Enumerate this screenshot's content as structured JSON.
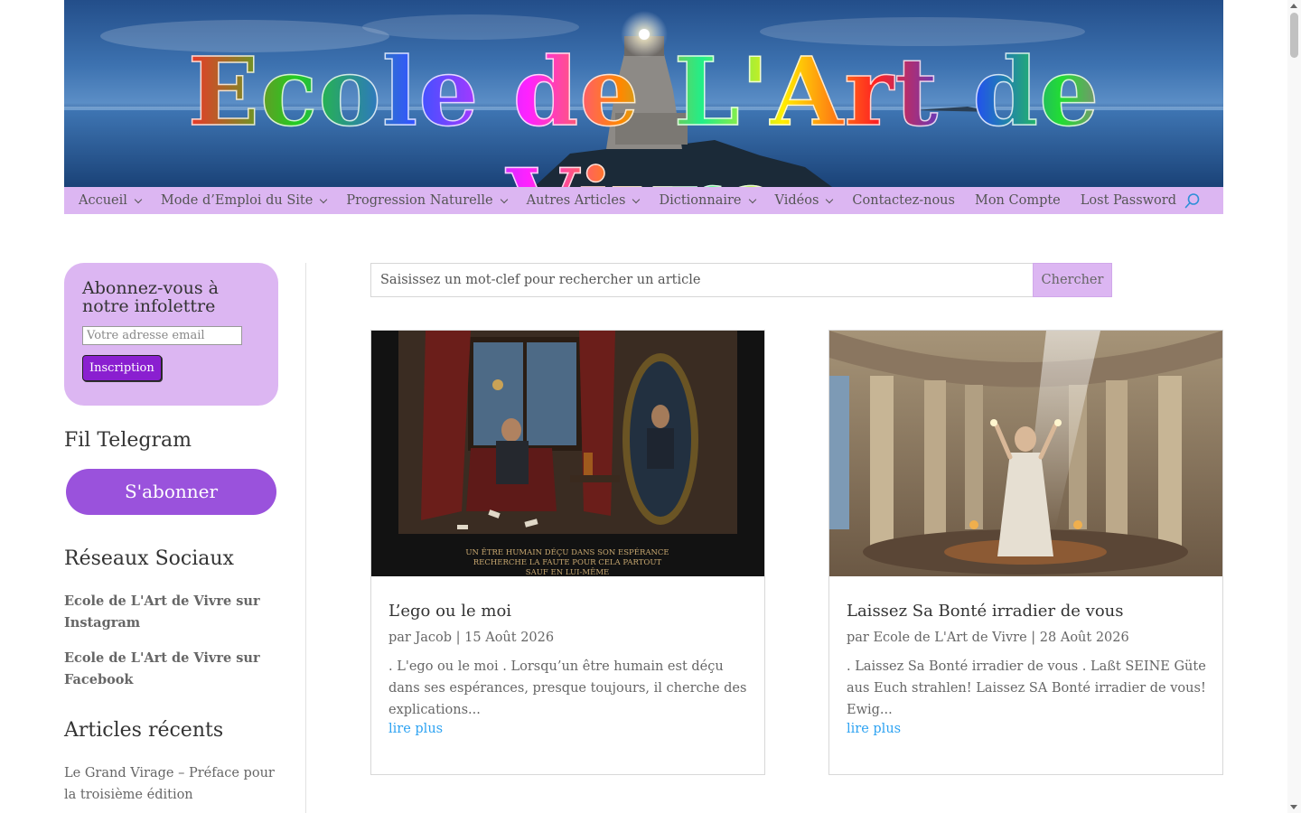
{
  "header": {
    "banner_title": "Ecole de L'Art de Vivre"
  },
  "nav": {
    "items": [
      {
        "label": "Accueil",
        "has_dropdown": true
      },
      {
        "label": "Mode d’Emploi du Site",
        "has_dropdown": true
      },
      {
        "label": "Progression Naturelle",
        "has_dropdown": true
      },
      {
        "label": "Autres Articles",
        "has_dropdown": true
      },
      {
        "label": "Dictionnaire",
        "has_dropdown": true
      },
      {
        "label": "Vidéos",
        "has_dropdown": true
      },
      {
        "label": "Contactez-nous",
        "has_dropdown": false
      },
      {
        "label": "Mon Compte",
        "has_dropdown": false
      },
      {
        "label": "Lost Password",
        "has_dropdown": false
      }
    ],
    "search_icon": "search-icon"
  },
  "sidebar": {
    "newsletter": {
      "title": "Abonnez-vous à notre infolettre",
      "email_placeholder": "Votre adresse email",
      "button_label": "Inscription"
    },
    "telegram": {
      "heading": "Fil Telegram",
      "button_label": "S'abonner"
    },
    "social": {
      "heading": "Réseaux Sociaux",
      "links": [
        "Ecole de L'Art de Vivre sur Instagram",
        "Ecole de L'Art de Vivre sur Facebook"
      ]
    },
    "recent": {
      "heading": "Articles récents",
      "links": [
        "Le Grand Virage – Préface pour la troisième édition"
      ]
    }
  },
  "search": {
    "placeholder": "Saisissez un mot-clef pour rechercher un article",
    "button_label": "Chercher"
  },
  "posts": [
    {
      "title": "L’ego ou le moi",
      "meta": "par Jacob | 15 Août 2026",
      "excerpt": ". L'ego ou le moi . Lorsqu’un être humain est déçu dans ses espérances, presque toujours, il cherche des explications...",
      "more": "lire plus",
      "image_caption": "UN ÊTRE HUMAIN DÉÇU DANS SON ESPÉRANCE RECHERCHE LA FAUTE POUR CELA PARTOUT SAUF EN LUI-MÊME"
    },
    {
      "title": "Laissez Sa Bonté irradier de vous",
      "meta": "par Ecole de L'Art de Vivre | 28 Août 2026",
      "excerpt": ". Laissez Sa Bonté irradier de vous . Laßt SEINE Güte aus Euch strahlen! Laissez SA Bonté irradier de vous! Ewig...",
      "more": "lire plus"
    }
  ],
  "colors": {
    "accent_lilac": "#dcb6f2",
    "button_purple": "#8a1fd0",
    "telegram_purple": "#9a52dc",
    "link_blue": "#2ea3f2"
  }
}
